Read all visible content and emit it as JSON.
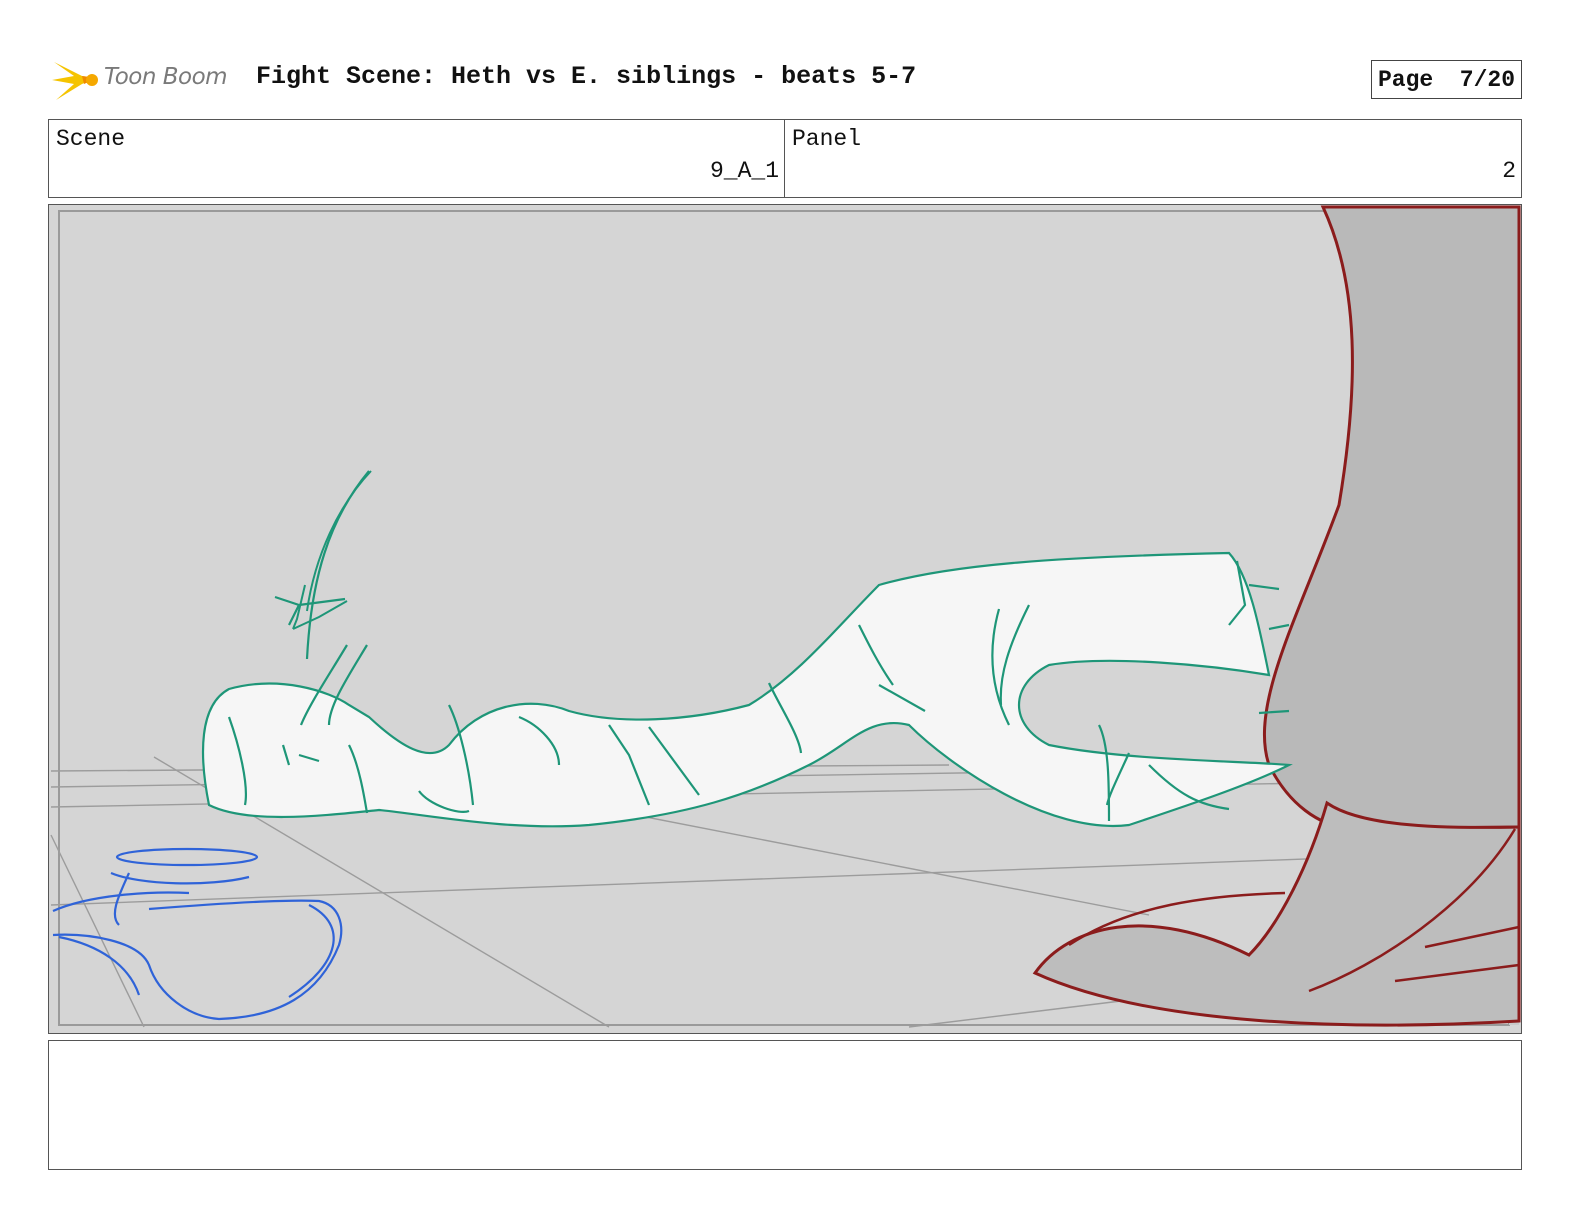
{
  "header": {
    "logo_text": "Toon Boom",
    "title": "Fight Scene: Heth vs E. siblings - beats 5-7",
    "page_label": "Page",
    "page_value": "7/20"
  },
  "info": {
    "scene_label": "Scene",
    "scene_value": "9_A_1",
    "panel_label": "Panel",
    "panel_value": "2"
  },
  "notes": {
    "text": ""
  },
  "colors": {
    "character_line": "#1e9678",
    "prop_line": "#2f63d8",
    "foreground_line": "#8b1c1c",
    "background": "#d5d5d5",
    "logo_accent": "#f5c400"
  }
}
